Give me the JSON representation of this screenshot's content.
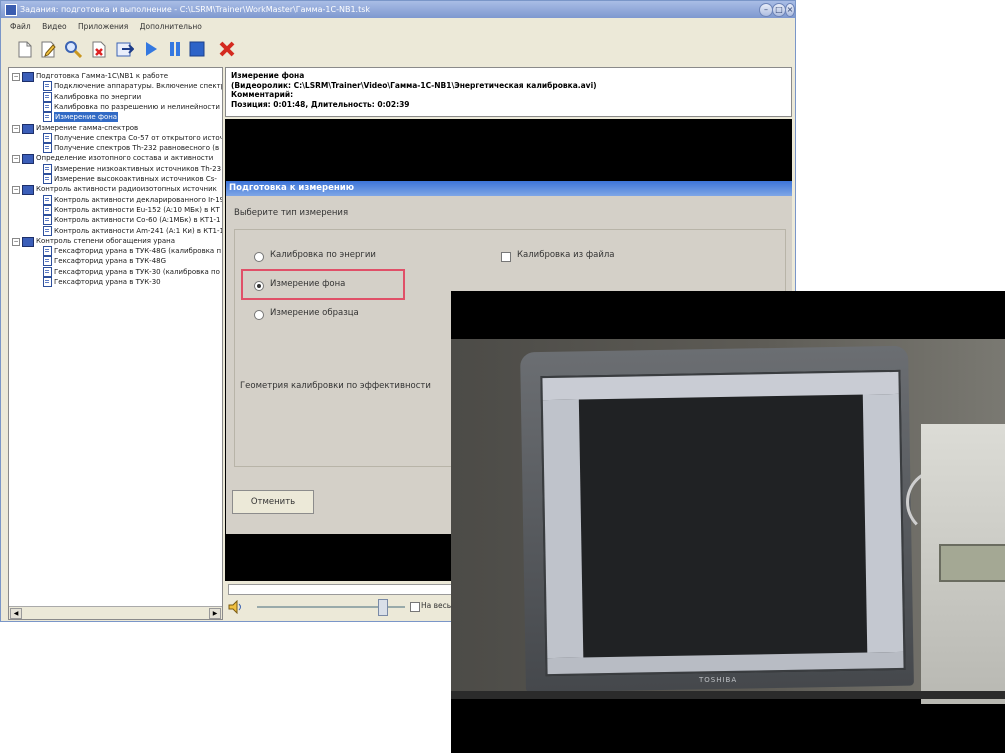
{
  "window": {
    "title": "Задания: подготовка и выполнение - C:\\LSRM\\Trainer\\WorkMaster\\Гамма-1С-NB1.tsk"
  },
  "menu": [
    "Файл",
    "Видео",
    "Приложения",
    "Дополнительно"
  ],
  "toolbar": {
    "icons": [
      "new-icon",
      "edit-icon",
      "search-icon",
      "delete-doc-icon",
      "export-icon",
      "play-icon",
      "pause-icon",
      "stop-icon",
      "close-icon"
    ]
  },
  "tree": {
    "items": [
      {
        "level": 0,
        "type": "group",
        "label": "Подготовка Гамма-1С\\NB1 к работе"
      },
      {
        "level": 1,
        "type": "task",
        "label": "Подключение аппаратуры. Включение спектр"
      },
      {
        "level": 1,
        "type": "task",
        "label": "Калибровка по энергии"
      },
      {
        "level": 1,
        "type": "task",
        "label": "Калибровка по разрешению и нелинейности"
      },
      {
        "level": 1,
        "type": "task",
        "label": "Измерение фона",
        "selected": true
      },
      {
        "level": 0,
        "type": "group",
        "label": "Измерение гамма-спектров"
      },
      {
        "level": 1,
        "type": "task",
        "label": "Получение спектра Co-57 от открытого источ"
      },
      {
        "level": 1,
        "type": "task",
        "label": "Получение спектров Th-232 равновесного (в"
      },
      {
        "level": 0,
        "type": "group",
        "label": "Определение изотопного состава и активности"
      },
      {
        "level": 1,
        "type": "task",
        "label": "Измерение низкоактивных источников Th-23"
      },
      {
        "level": 1,
        "type": "task",
        "label": "Измерение высокоактивных источников Cs-"
      },
      {
        "level": 0,
        "type": "group",
        "label": "Контроль активности радиоизотопных источник"
      },
      {
        "level": 1,
        "type": "task",
        "label": "Контроль активности декларированного Ir-19"
      },
      {
        "level": 1,
        "type": "task",
        "label": "Контроль активности Eu-152 (A:10 МБк) в КТ"
      },
      {
        "level": 1,
        "type": "task",
        "label": "Контроль активности Co-60 (A:1МБк) в КТ1-1"
      },
      {
        "level": 1,
        "type": "task",
        "label": "Контроль активности Am-241 (A:1 Ки) в КТ1-1"
      },
      {
        "level": 0,
        "type": "group",
        "label": "Контроль степени обогащения урана"
      },
      {
        "level": 1,
        "type": "task",
        "label": "Гексафторид урана в ТУК-48G (калибровка п"
      },
      {
        "level": 1,
        "type": "task",
        "label": "Гексафторид урана в ТУК-48G"
      },
      {
        "level": 1,
        "type": "task",
        "label": "Гексафторид урана в ТУК-30 (калибровка по"
      },
      {
        "level": 1,
        "type": "task",
        "label": "Гексафторид урана в ТУК-30"
      }
    ]
  },
  "info": {
    "title": "Измерение фона",
    "video": "(Видеоролик: C:\\LSRM\\Trainer\\Video\\Гамма-1С-NB1\\Энергетическая калибровка.avi)",
    "comment": "Комментарий:",
    "position": "Позиция: 0:01:48, Длительность: 0:02:39"
  },
  "dialog": {
    "title": "Подготовка к измерению",
    "prompt": "Выберите тип измерения",
    "options": [
      {
        "label": "Калибровка по энергии",
        "checked": false
      },
      {
        "label": "Измерение фона",
        "checked": true
      },
      {
        "label": "Измерение образца",
        "checked": false
      }
    ],
    "checkbox_label": "Калибровка из файла",
    "geometry_text": "Геометрия калибровки по эффективности",
    "cancel_label": "Отменить"
  },
  "player": {
    "fullscreen_label": "На весь",
    "volume_level": 0.85
  },
  "photo": {
    "brand": "TOSHIBA"
  }
}
